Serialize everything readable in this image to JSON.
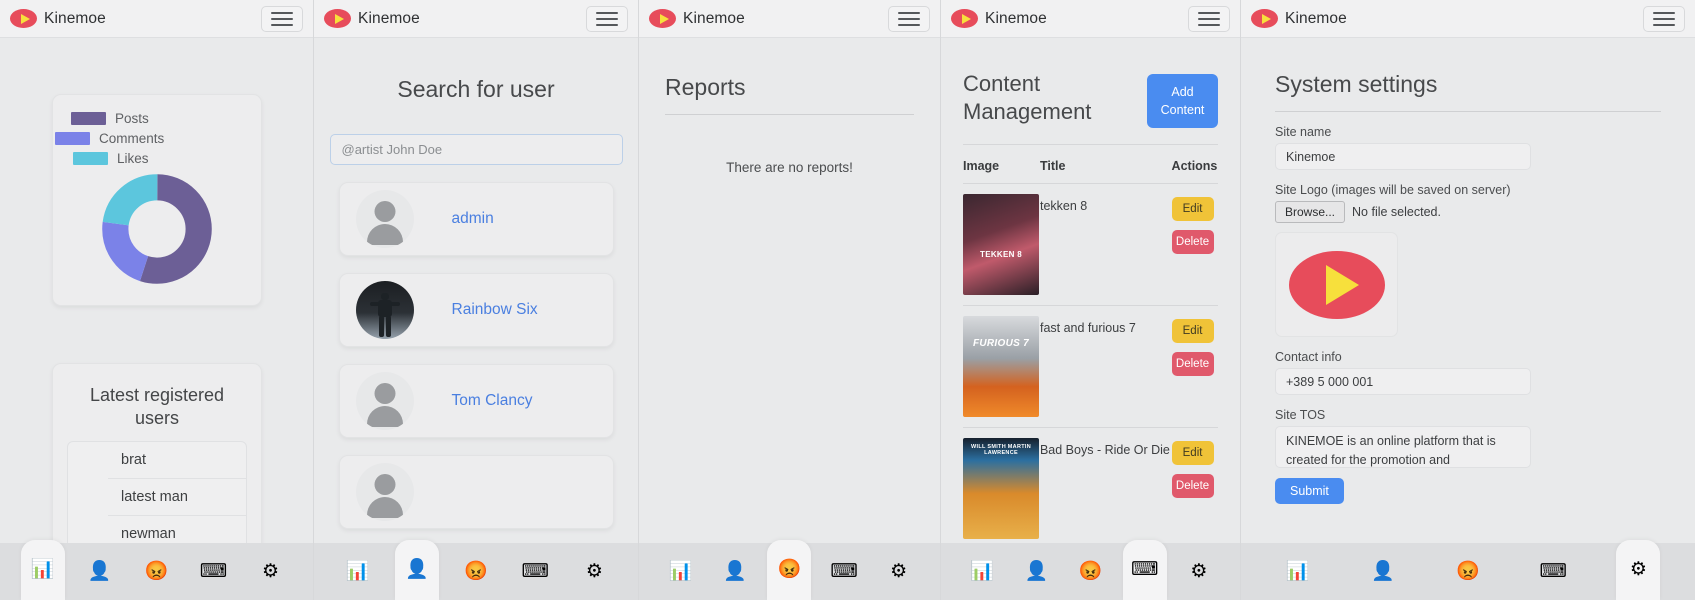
{
  "brand": {
    "name": "Kinemoe",
    "logo_icon": "play-logo-icon",
    "menu_icon": "hamburger-menu-icon"
  },
  "nav": {
    "items": [
      {
        "icon": "bar-chart-icon",
        "glyph": "📊",
        "name": "dashboard"
      },
      {
        "icon": "user-bust-icon",
        "glyph": "👤",
        "name": "users"
      },
      {
        "icon": "angry-face-icon",
        "glyph": "😡",
        "name": "reports"
      },
      {
        "icon": "keyboard-icon",
        "glyph": "⌨",
        "name": "content"
      },
      {
        "icon": "gear-icon",
        "glyph": "⚙",
        "name": "settings"
      }
    ]
  },
  "panel1": {
    "chart_data": {
      "type": "pie",
      "title": "",
      "legend_position": "top",
      "categories": [
        "Posts",
        "Comments",
        "Likes"
      ],
      "values": [
        55,
        22,
        23
      ],
      "colors": [
        "#6c5f96",
        "#7b82e8",
        "#5cc6dd"
      ],
      "donut": true,
      "inner_radius_ratio": 0.52
    },
    "users_card": {
      "title": "Latest registered users",
      "users": [
        "brat",
        "latest man",
        "newman"
      ]
    }
  },
  "panel2": {
    "title": "Search for user",
    "search": {
      "placeholder": "@artist John Doe",
      "value": ""
    },
    "results": [
      {
        "name": "admin",
        "avatar": "placeholder"
      },
      {
        "name": "Rainbow Six",
        "avatar": "photo"
      },
      {
        "name": "Tom Clancy",
        "avatar": "placeholder"
      },
      {
        "name": "",
        "avatar": "placeholder"
      }
    ]
  },
  "panel3": {
    "title": "Reports",
    "empty_message": "There are no reports!"
  },
  "panel4": {
    "title": "Content Management",
    "add_button": "Add Content",
    "columns": [
      "Image",
      "Title",
      "Actions"
    ],
    "rows": [
      {
        "title": "tekken 8",
        "poster_label": "TEKKEN 8",
        "edit": "Edit",
        "delete": "Delete"
      },
      {
        "title": "fast and furious 7",
        "poster_label": "FURIOUS 7",
        "edit": "Edit",
        "delete": "Delete"
      },
      {
        "title": "Bad Boys - Ride Or Die",
        "poster_label": "WILL SMITH   MARTIN LAWRENCE",
        "edit": "Edit",
        "delete": "Delete"
      }
    ]
  },
  "panel5": {
    "title": "System settings",
    "site_name_label": "Site name",
    "site_name_value": "Kinemoe",
    "site_logo_label": "Site Logo (images will be saved on server)",
    "browse_button": "Browse...",
    "no_file_text": "No file selected.",
    "contact_label": "Contact info",
    "contact_value": "+389 5 000 001",
    "tos_label": "Site TOS",
    "tos_value": "KINEMOE is an online platform that is created for the promotion and presentation",
    "submit_button": "Submit"
  },
  "colors": {
    "accent_blue": "#4a8cf0",
    "brand_red": "#e74c5b",
    "brand_yellow": "#f7e03c",
    "edit_yellow": "#f0c338",
    "delete_red": "#e0596b",
    "link_blue": "#4a7fe0"
  }
}
